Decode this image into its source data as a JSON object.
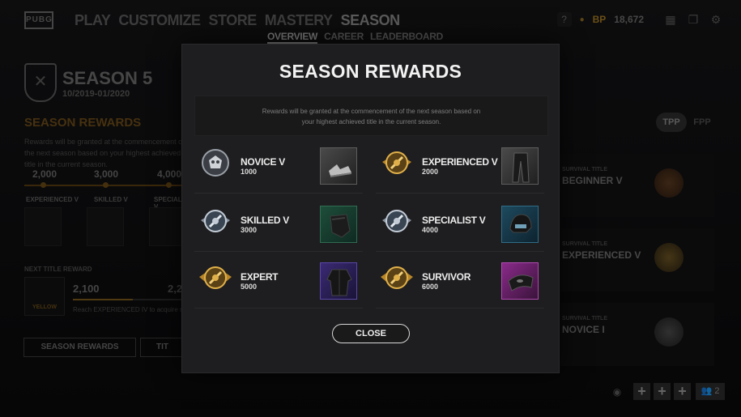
{
  "topbar": {
    "logo": "PUBG",
    "nav": [
      "PLAY",
      "CUSTOMIZE",
      "STORE",
      "MASTERY",
      "SEASON"
    ],
    "subnav": [
      "OVERVIEW",
      "CAREER",
      "LEADERBOARD"
    ],
    "help": "?",
    "bp_label": "BP",
    "bp_value": "18,672"
  },
  "season": {
    "title": "SEASON 5",
    "dates": "10/2019-01/2020",
    "rewards_heading": "SEASON REWARDS",
    "description": "Rewards will be granted at the commencement of the next season based on your highest achieved title in the current season.",
    "track_numbers": [
      "2,000",
      "3,000",
      "4,000"
    ],
    "track_tiers": [
      "EXPERIENCED V",
      "SKILLED V",
      "SPECIALIST V"
    ],
    "next_title_reward_label": "NEXT TITLE REWARD",
    "next_tile_label": "YELLOW",
    "next_value": "2,100",
    "next_value2": "2,20",
    "next_hint": "Reach EXPERIENCED IV to acquire next rewa",
    "next_progress": 0.55,
    "buttons": [
      "SEASON REWARDS",
      "TIT"
    ]
  },
  "right_panel": {
    "mode_tabs": [
      "TPP",
      "FPP"
    ],
    "cards": [
      {
        "label": "SURVIVAL TITLE",
        "value": "BEGINNER V"
      },
      {
        "label": "SURVIVAL TITLE",
        "value": "EXPERIENCED V"
      },
      {
        "label": "SURVIVAL TITLE",
        "value": "NOVICE I"
      }
    ],
    "party_count": "2"
  },
  "modal": {
    "title": "SEASON REWARDS",
    "description": "Rewards will be granted at the commencement of the next season based on your highest achieved title in the current season.",
    "rewards": [
      {
        "name": "NOVICE V",
        "points": "1000",
        "badge": "silver-skull-badge-icon",
        "item": "shoes-icon",
        "item_color": "gray"
      },
      {
        "name": "EXPERIENCED V",
        "points": "2000",
        "badge": "gold-winged-badge-icon",
        "item": "pants-icon",
        "item_color": "gray"
      },
      {
        "name": "SKILLED V",
        "points": "3000",
        "badge": "silver-winged-badge-icon",
        "item": "backpack-icon",
        "item_color": "green"
      },
      {
        "name": "SPECIALIST V",
        "points": "4000",
        "badge": "silver-winged-badge-icon",
        "item": "helmet-icon",
        "item_color": "teal"
      },
      {
        "name": "EXPERT",
        "points": "5000",
        "badge": "gold-winged-badge-icon",
        "item": "jacket-icon",
        "item_color": "purple"
      },
      {
        "name": "SURVIVOR",
        "points": "6000",
        "badge": "gold-winged-badge-icon",
        "item": "mask-icon",
        "item_color": "pink"
      }
    ],
    "close_label": "CLOSE"
  },
  "colors": {
    "accent_gold": "#c79a2c",
    "modal_bg": "#1e1e20",
    "text_white": "#f2f2f2"
  }
}
